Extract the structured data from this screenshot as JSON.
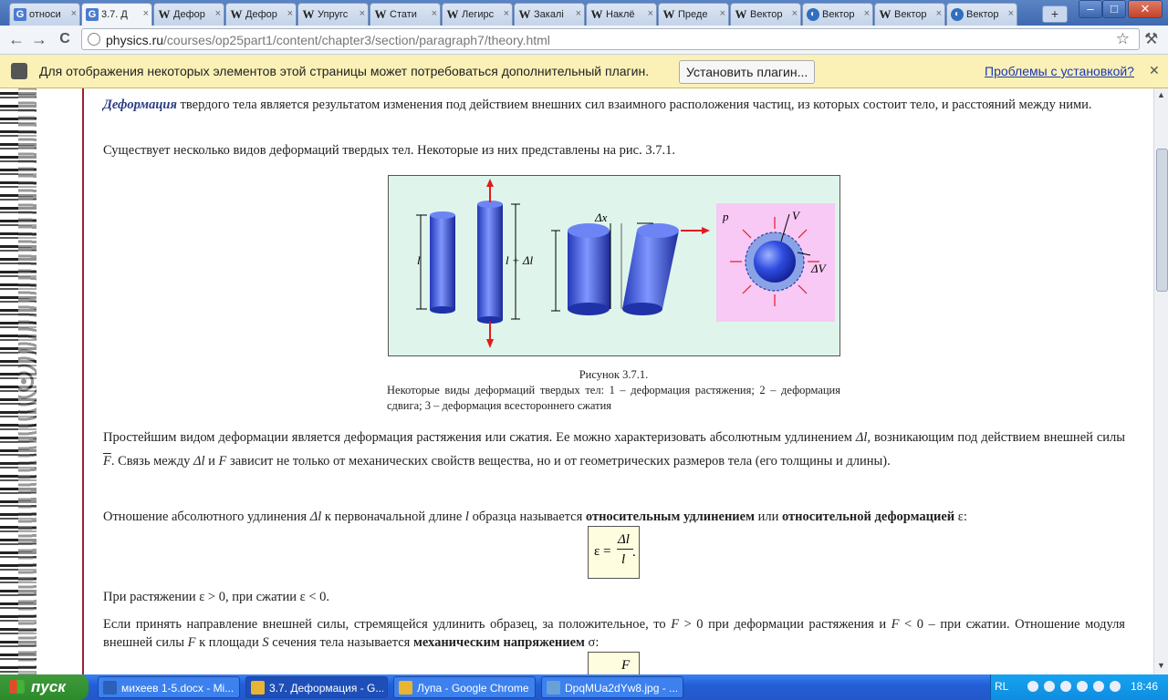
{
  "browser": {
    "tabs": [
      {
        "label": "относи",
        "icon": "g"
      },
      {
        "label": "3.7. Д",
        "icon": "g",
        "active": true
      },
      {
        "label": "Дефор",
        "icon": "w"
      },
      {
        "label": "Дефор",
        "icon": "w"
      },
      {
        "label": "Упругс",
        "icon": "w"
      },
      {
        "label": "Стати",
        "icon": "w"
      },
      {
        "label": "Легирс",
        "icon": "w"
      },
      {
        "label": "Закалі",
        "icon": "w"
      },
      {
        "label": "Наклё",
        "icon": "w"
      },
      {
        "label": "Преде",
        "icon": "w"
      },
      {
        "label": "Вектор",
        "icon": "w"
      },
      {
        "label": "Вектор",
        "icon": "d"
      },
      {
        "label": "Вектор",
        "icon": "w"
      },
      {
        "label": "Вектор",
        "icon": "d"
      }
    ],
    "tab_close": "×",
    "new_tab": "+",
    "window": {
      "minimize": "–",
      "maximize": "□",
      "close": "✕"
    },
    "nav": {
      "back": "←",
      "forward": "→",
      "reload": "C"
    },
    "url": {
      "host": "physics.ru",
      "path": "/courses/op25part1/content/chapter3/section/paragraph7/theory.html"
    },
    "star": "☆",
    "menu": "⚒"
  },
  "infobar": {
    "message": "Для отображения некоторых элементов этой страницы может потребоваться дополнительный плагин.",
    "install_button": "Установить плагин...",
    "problems_link": "Проблемы с установкой?",
    "close": "✕"
  },
  "article": {
    "p1_term": "Деформация",
    "p1_rest": " твердого тела является результатом изменения под действием внешних сил взаимного расположения частиц, из которых состоит тело, и расстояний между ними.",
    "p2": "Существует несколько видов деформаций твердых тел. Некоторые из них представлены на рис. 3.7.1.",
    "figure": {
      "label_l": "l",
      "label_l_dl": "l + Δl",
      "label_dx": "Δx",
      "label_p": "p",
      "label_v": "V",
      "label_dv": "ΔV"
    },
    "caption_title": "Рисунок 3.7.1.",
    "caption_body": "Некоторые виды деформаций твердых тел: 1 – деформация растяжения; 2 – деформация сдвига; 3 – деформация всестороннего сжатия",
    "p3_a": "Простейшим видом деформации является деформация растяжения или сжатия. Ее можно характеризовать абсолютным удлинением ",
    "p3_dl": "Δl",
    "p3_b": ", возникающим под действием внешней силы ",
    "p3_f": "F",
    "p3_c": ". Связь между ",
    "p3_d": " и ",
    "p3_e": " зависит не только от механических свойств вещества, но и от геометрических размеров тела (его толщины и длины).",
    "p4_a": "Отношение абсолютного удлинения ",
    "p4_b": " к первоначальной длине ",
    "p4_l": "l",
    "p4_c": " образца называется ",
    "p4_bold1": "относительным удлинением",
    "p4_or": " или ",
    "p4_bold2": "относительной деформацией",
    "p4_eps": " ε:",
    "formula1": {
      "lhs": "ε =",
      "num": "Δl",
      "den": "l",
      "tail": "."
    },
    "p5": "При растяжении ε > 0, при сжатии ε < 0.",
    "p6_a": "Если принять направление внешней силы, стремящейся удлинить образец, за положительное, то ",
    "p6_b": " > 0 при деформации растяжения и ",
    "p6_c": " < 0 – при сжатии. Отношение модуля внешней силы ",
    "p6_d": " к площади ",
    "p6_s": "S",
    "p6_e": " сечения тела называется ",
    "p6_bold": "механическим напряжением",
    "p6_sigma": " σ:",
    "formula2_num": "F"
  },
  "taskbar": {
    "start": "пуск",
    "tasks": [
      {
        "label": "михеев 1-5.docx - Mi...",
        "color": "#2b5fb8"
      },
      {
        "label": "3.7. Деформация - G...",
        "color": "#e8b432",
        "active": true
      },
      {
        "label": "Лупа - Google Chrome",
        "color": "#e8b432"
      },
      {
        "label": "DpqMUa2dYw8.jpg - ...",
        "color": "#6aa0d8"
      }
    ],
    "lang": "RL",
    "clock": "18:46"
  }
}
